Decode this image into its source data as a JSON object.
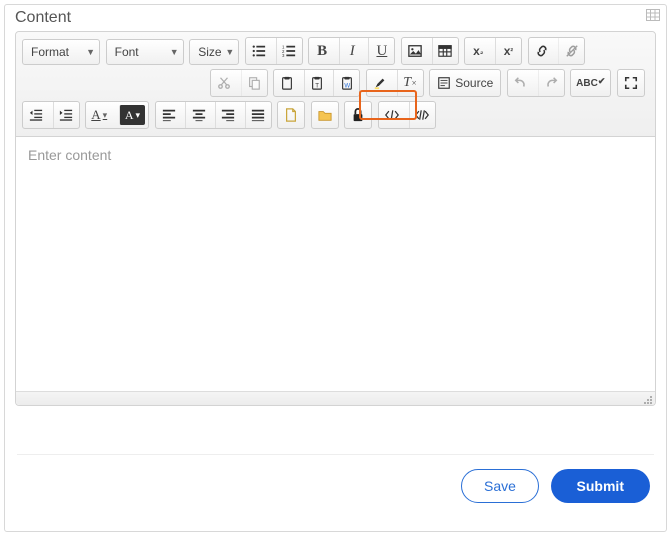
{
  "panel": {
    "title": "Content"
  },
  "toolbar": {
    "format_label": "Format",
    "font_label": "Font",
    "size_label": "Size",
    "source_label": "Source"
  },
  "editor": {
    "placeholder": "Enter content"
  },
  "buttons": {
    "save": "Save",
    "submit": "Submit"
  }
}
